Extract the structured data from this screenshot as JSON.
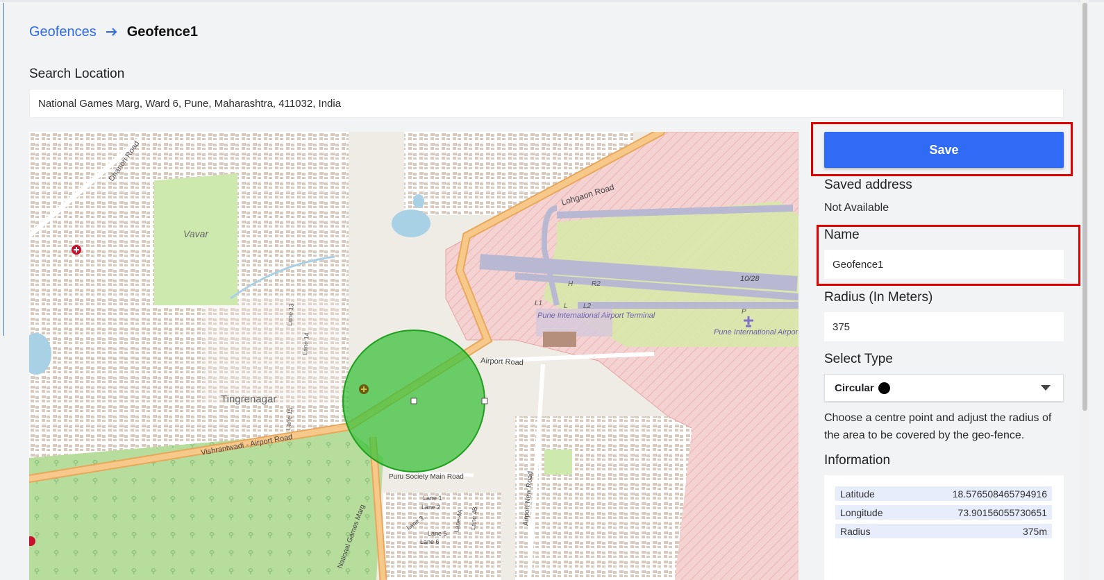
{
  "breadcrumb": {
    "parent": "Geofences",
    "current": "Geofence1"
  },
  "search": {
    "label": "Search Location",
    "value": "National Games Marg, Ward 6, Pune, Maharashtra, 411032, India"
  },
  "actions": {
    "save_label": "Save"
  },
  "saved_address": {
    "label": "Saved address",
    "value": "Not Available"
  },
  "name": {
    "label": "Name",
    "value": "Geofence1"
  },
  "radius": {
    "label": "Radius (In Meters)",
    "value": "375"
  },
  "type": {
    "label": "Select Type",
    "value": "Circular",
    "icon": "black-dot"
  },
  "help_text": "Choose a centre point and adjust the radius of the area to be covered by the geo-fence.",
  "information": {
    "label": "Information",
    "rows": [
      {
        "key": "Latitude",
        "value": "18.576508465794916"
      },
      {
        "key": "Longitude",
        "value": "73.90156055730651"
      },
      {
        "key": "Radius",
        "value": "375m"
      }
    ]
  },
  "map": {
    "labels": {
      "dhanori": "Dhanori Road",
      "lohgaon": "Lohgaon Road",
      "vavar": "Vavar",
      "tingrenagar": "Tingrenagar",
      "airport_road": "Airport Road",
      "vishrantwadi": "Vishrantwadi - Airport Road",
      "terminal": "Pune International Airport Terminal",
      "airport": "Pune International Airport",
      "runway": "10/28",
      "puru": "Puru Society Main Road",
      "national_games": "National Games Marg",
      "airport_new": "Airport New Road",
      "lane13": "Lane 13",
      "lane14": "Lane 14",
      "lane15": "Lane 15",
      "lane1": "Lane 1",
      "lane2": "Lane 2",
      "lane3": "Lane 3",
      "lane4a": "Lane 4A",
      "lane4b": "Lane 4B",
      "lane5": "Lane 5",
      "lane6": "Lane 6",
      "r2": "R2",
      "h": "H",
      "l1": "L1",
      "l2": "L2",
      "l": "L",
      "p": "P"
    },
    "colors": {
      "fence_fill": "#3cc13c",
      "fence_stroke": "#1ea01e",
      "main_road": "#f6c98a",
      "park": "#bfe3a1",
      "airport_zone": "#f2cfcf"
    }
  }
}
